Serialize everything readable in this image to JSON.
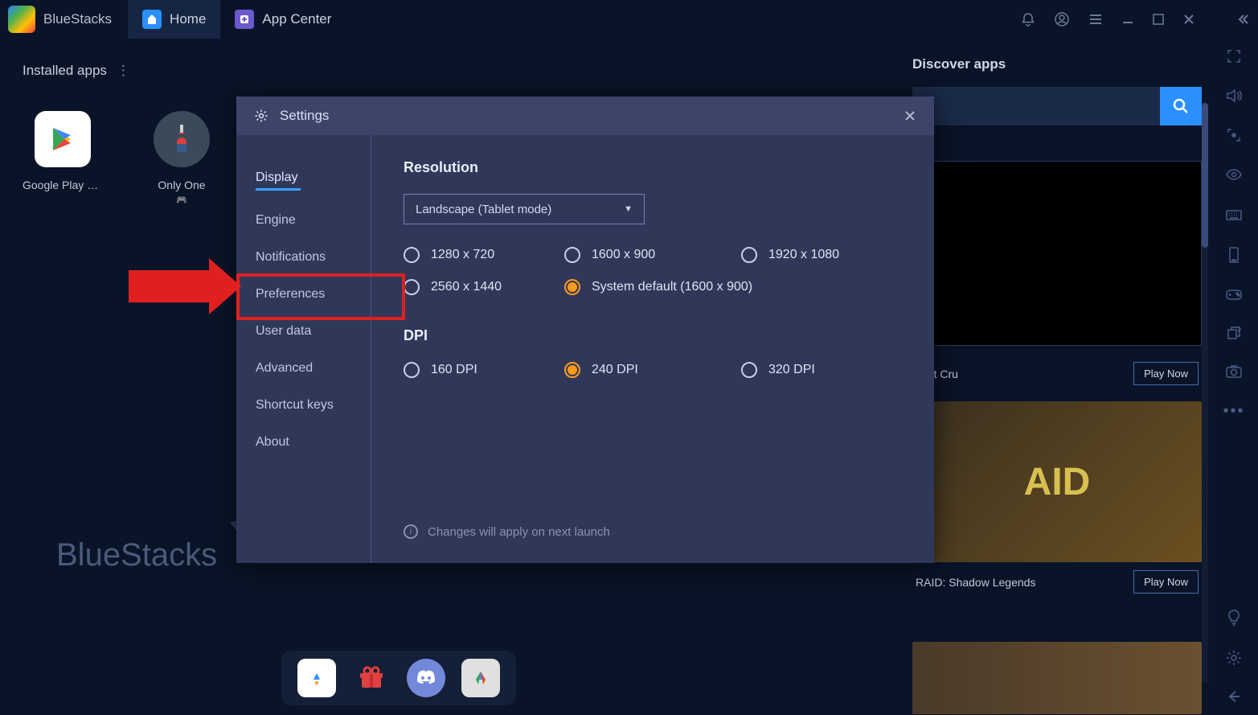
{
  "titlebar": {
    "app_name": "BlueStacks",
    "tabs": [
      {
        "label": "Home",
        "active": true
      },
      {
        "label": "App Center",
        "active": false
      }
    ]
  },
  "main": {
    "installed_header": "Installed apps",
    "apps": [
      {
        "label": "Google Play Store"
      },
      {
        "label": "Only One"
      }
    ],
    "watermark": "BlueStacks"
  },
  "discover": {
    "header": "Discover apps",
    "promo1_title": "Lost Cru",
    "promo1_btn": "Play Now",
    "promo2_text": "AID",
    "promo2_title": "RAID: Shadow Legends",
    "promo2_btn": "Play Now"
  },
  "settings": {
    "title": "Settings",
    "nav": [
      "Display",
      "Engine",
      "Notifications",
      "Preferences",
      "User data",
      "Advanced",
      "Shortcut keys",
      "About"
    ],
    "active_nav": "Display",
    "resolution": {
      "title": "Resolution",
      "mode": "Landscape (Tablet mode)",
      "options": [
        "1280 x 720",
        "1600 x 900",
        "1920 x 1080",
        "2560 x 1440",
        "System default (1600 x 900)"
      ],
      "selected": "System default (1600 x 900)"
    },
    "dpi": {
      "title": "DPI",
      "options": [
        "160 DPI",
        "240 DPI",
        "320 DPI"
      ],
      "selected": "240 DPI"
    },
    "note": "Changes will apply on next launch"
  }
}
